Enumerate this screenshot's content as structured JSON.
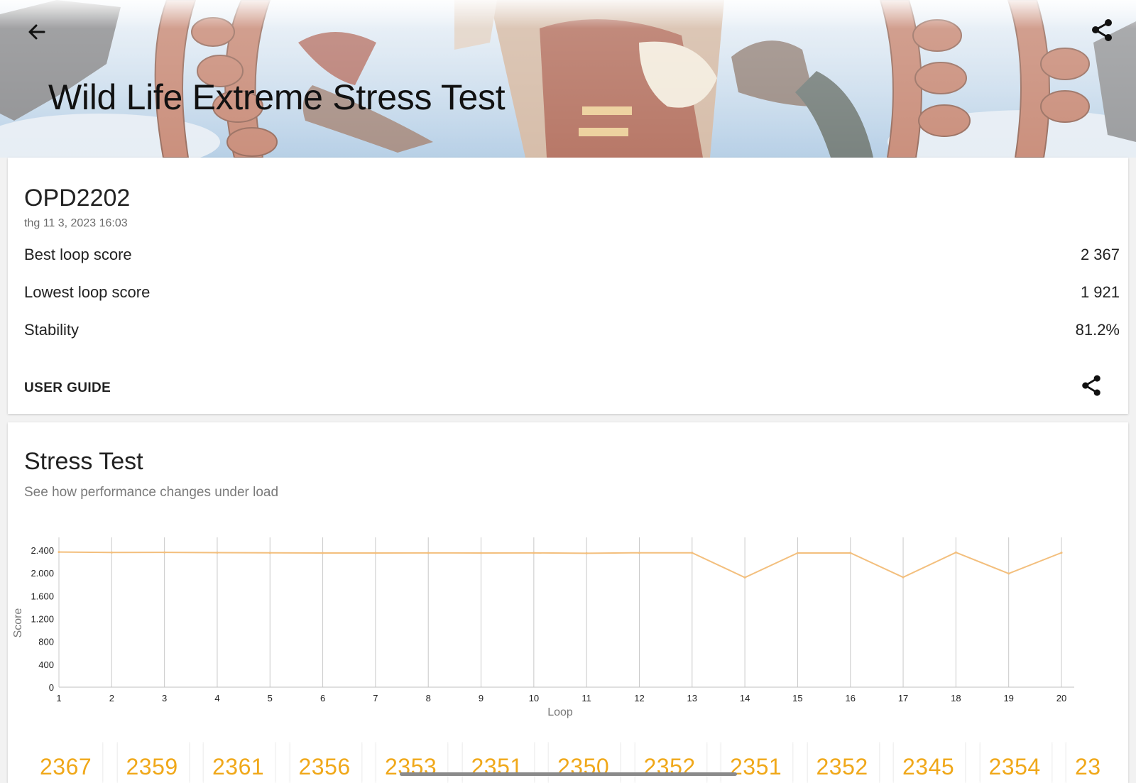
{
  "header": {
    "title": "Wild Life Extreme Stress Test",
    "back_icon": "arrow-left-icon",
    "share_icon": "share-icon"
  },
  "result": {
    "device": "OPD2202",
    "date": "thg 11 3, 2023 16:03",
    "metrics": [
      {
        "label": "Best loop score",
        "value": "2 367"
      },
      {
        "label": "Lowest loop score",
        "value": "1 921"
      },
      {
        "label": "Stability",
        "value": "81.2%"
      }
    ],
    "user_guide": "USER GUIDE"
  },
  "stress": {
    "title": "Stress Test",
    "subtitle": "See how performance changes under load",
    "loop_scores": [
      "2367",
      "2359",
      "2361",
      "2356",
      "2353",
      "2351",
      "2350",
      "2352",
      "2351",
      "2352",
      "2345",
      "2354",
      "23"
    ]
  },
  "colors": {
    "line": "#f3bf7d",
    "loop_score_text": "#f0a81a"
  },
  "chart_data": {
    "type": "line",
    "xlabel": "Loop",
    "ylabel": "Score",
    "x": [
      1,
      2,
      3,
      4,
      5,
      6,
      7,
      8,
      9,
      10,
      11,
      12,
      13,
      14,
      15,
      16,
      17,
      18,
      19,
      20
    ],
    "y_ticks": [
      "0",
      "400",
      "800",
      "1.200",
      "1.600",
      "2.000",
      "2.400"
    ],
    "y_tick_values": [
      0,
      400,
      800,
      1200,
      1600,
      2000,
      2400
    ],
    "ylim": [
      0,
      2400
    ],
    "grid": "vertical",
    "series": [
      {
        "values": [
          2367,
          2359,
          2361,
          2356,
          2353,
          2351,
          2350,
          2352,
          2351,
          2352,
          2345,
          2354,
          2354,
          1921,
          2350,
          2352,
          1925,
          2360,
          1990,
          2355
        ]
      }
    ]
  }
}
